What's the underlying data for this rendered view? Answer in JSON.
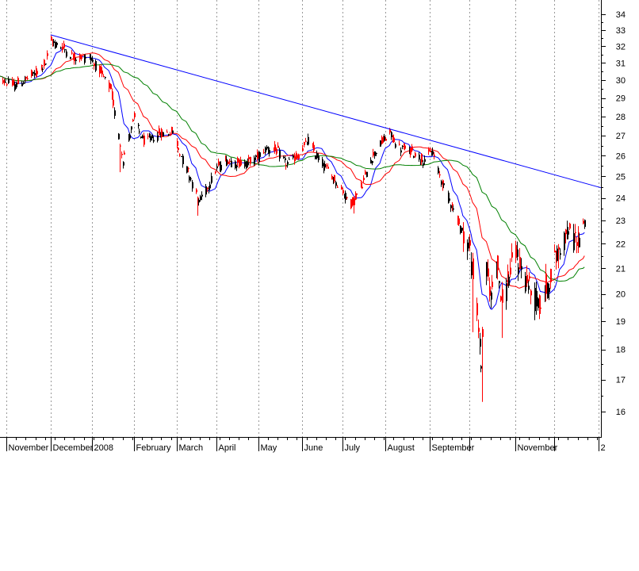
{
  "chart_data": {
    "type": "candlestick",
    "title": "",
    "xlabel": "",
    "ylabel": "",
    "ylim": [
      15.2,
      35.0
    ],
    "y_scale": "log",
    "grid": "vertical dashed at month starts",
    "y_ticks": [
      "16",
      "17",
      "18",
      "19",
      "20",
      "21",
      "22",
      "23",
      "24",
      "25",
      "26",
      "27",
      "28",
      "29",
      "30",
      "31",
      "32",
      "33",
      "34"
    ],
    "x_labels": [
      {
        "label": "November",
        "date": "2007-11-01"
      },
      {
        "label": "December",
        "date": "2007-12-03"
      },
      {
        "label": "2008",
        "date": "2008-01-02"
      },
      {
        "label": "February",
        "date": "2008-02-01"
      },
      {
        "label": "March",
        "date": "2008-03-03"
      },
      {
        "label": "April",
        "date": "2008-04-01"
      },
      {
        "label": "May",
        "date": "2008-05-01"
      },
      {
        "label": "June",
        "date": "2008-06-02"
      },
      {
        "label": "July",
        "date": "2008-07-01"
      },
      {
        "label": "August",
        "date": "2008-08-01"
      },
      {
        "label": "September",
        "date": "2008-09-02"
      },
      {
        "label": "",
        "date": "2008-10-01"
      },
      {
        "label": "November",
        "date": "2008-11-03"
      },
      {
        "label": "",
        "date": "2008-12-01"
      },
      {
        "label": "2",
        "date": "2009-01-02"
      }
    ],
    "price_anchors": [
      [
        "2007-10-22",
        30.3
      ],
      [
        "2007-11-06",
        29.7
      ],
      [
        "2007-11-14",
        30.0
      ],
      [
        "2007-11-22",
        30.4
      ],
      [
        "2007-11-29",
        31.0
      ],
      [
        "2007-12-03",
        32.3
      ],
      [
        "2007-12-12",
        31.9
      ],
      [
        "2007-12-20",
        31.3
      ],
      [
        "2007-12-31",
        31.4
      ],
      [
        "2008-01-08",
        30.4
      ],
      [
        "2008-01-15",
        29.5
      ],
      [
        "2008-01-21",
        27.0
      ],
      [
        "2008-01-24",
        25.8
      ],
      [
        "2008-02-01",
        27.9
      ],
      [
        "2008-02-08",
        26.7
      ],
      [
        "2008-02-20",
        27.1
      ],
      [
        "2008-02-29",
        27.2
      ],
      [
        "2008-03-06",
        26.0
      ],
      [
        "2008-03-13",
        24.9
      ],
      [
        "2008-03-19",
        23.8
      ],
      [
        "2008-03-26",
        24.6
      ],
      [
        "2008-04-01",
        25.4
      ],
      [
        "2008-04-08",
        25.8
      ],
      [
        "2008-04-18",
        25.6
      ],
      [
        "2008-04-28",
        25.8
      ],
      [
        "2008-05-07",
        26.4
      ],
      [
        "2008-05-15",
        26.2
      ],
      [
        "2008-05-21",
        25.6
      ],
      [
        "2008-05-30",
        26.0
      ],
      [
        "2008-06-06",
        26.8
      ],
      [
        "2008-06-11",
        26.1
      ],
      [
        "2008-06-20",
        25.3
      ],
      [
        "2008-06-30",
        24.4
      ],
      [
        "2008-07-07",
        23.7
      ],
      [
        "2008-07-15",
        24.6
      ],
      [
        "2008-07-21",
        25.8
      ],
      [
        "2008-07-28",
        26.6
      ],
      [
        "2008-08-04",
        27.1
      ],
      [
        "2008-08-11",
        26.4
      ],
      [
        "2008-08-20",
        26.2
      ],
      [
        "2008-08-28",
        25.8
      ],
      [
        "2008-09-04",
        26.2
      ],
      [
        "2008-09-10",
        24.8
      ],
      [
        "2008-09-17",
        23.8
      ],
      [
        "2008-09-24",
        22.7
      ],
      [
        "2008-10-01",
        21.8
      ],
      [
        "2008-10-06",
        19.3
      ],
      [
        "2008-10-09",
        17.6
      ],
      [
        "2008-10-13",
        20.9
      ],
      [
        "2008-10-16",
        19.9
      ],
      [
        "2008-10-20",
        21.5
      ],
      [
        "2008-10-24",
        19.6
      ],
      [
        "2008-10-28",
        20.5
      ],
      [
        "2008-11-03",
        21.6
      ],
      [
        "2008-11-07",
        21.0
      ],
      [
        "2008-11-13",
        20.3
      ],
      [
        "2008-11-20",
        19.6
      ],
      [
        "2008-11-25",
        20.2
      ],
      [
        "2008-12-01",
        21.3
      ],
      [
        "2008-12-08",
        22.3
      ],
      [
        "2008-12-12",
        22.6
      ],
      [
        "2008-12-18",
        22.1
      ],
      [
        "2008-12-23",
        22.9
      ]
    ],
    "spikes": [
      {
        "date": "2008-01-22",
        "low": 25.2
      },
      {
        "date": "2008-03-18",
        "low": 23.2
      },
      {
        "date": "2008-07-09",
        "low": 23.3
      },
      {
        "date": "2008-10-03",
        "low": 18.6
      },
      {
        "date": "2008-10-10",
        "low": 16.3
      },
      {
        "date": "2008-10-24",
        "low": 18.4
      },
      {
        "date": "2008-11-20",
        "low": 19.1
      },
      {
        "date": "2008-12-04",
        "low": 21.0
      }
    ],
    "moving_averages": [
      {
        "name": "",
        "period": 10,
        "color": "#0000ff"
      },
      {
        "name": "",
        "period": 25,
        "color": "#ff0000"
      },
      {
        "name": "",
        "period": 50,
        "color": "#008000"
      }
    ],
    "trendline": {
      "color": "#0000ff",
      "from": {
        "date": "2007-12-03",
        "value": 32.7
      },
      "to": {
        "date": "2009-01-02",
        "value": 24.5
      }
    },
    "colors": {
      "up": "#000000",
      "down": "#ff0000",
      "grid": "#999999",
      "axis": "#000000"
    }
  }
}
